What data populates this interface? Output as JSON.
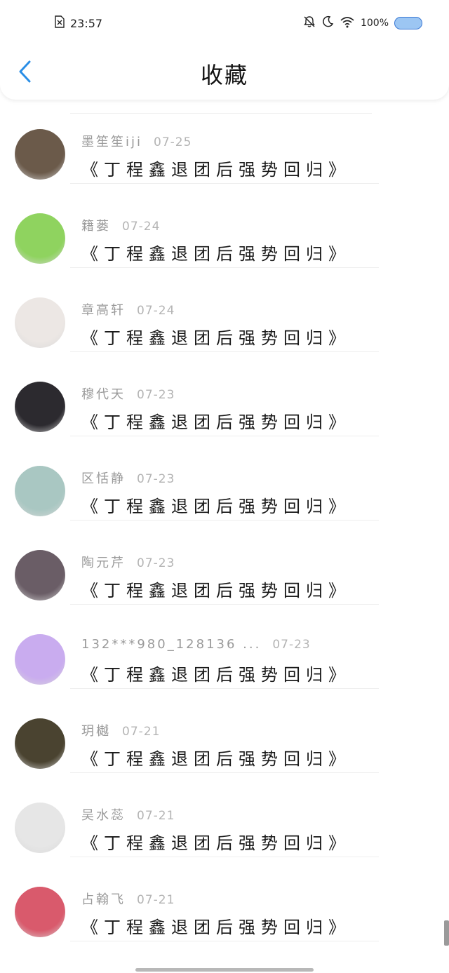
{
  "status": {
    "time": "23:57",
    "battery": "100%"
  },
  "header": {
    "title": "收藏"
  },
  "items": [
    {
      "author": "墨笙笙iji",
      "date": "07-25",
      "title": "《丁程鑫退团后强势回归》",
      "avatar_color": "#6b5a4a"
    },
    {
      "author": "籍蒌",
      "date": "07-24",
      "title": "《丁程鑫退团后强势回归》",
      "avatar_color": "#8fd35f"
    },
    {
      "author": "章高轩",
      "date": "07-24",
      "title": "《丁程鑫退团后强势回归》",
      "avatar_color": "#ece7e4"
    },
    {
      "author": "穆代天",
      "date": "07-23",
      "title": "《丁程鑫退团后强势回归》",
      "avatar_color": "#2c2a2f"
    },
    {
      "author": "区恬静",
      "date": "07-23",
      "title": "《丁程鑫退团后强势回归》",
      "avatar_color": "#a9c7c2"
    },
    {
      "author": "陶元芹",
      "date": "07-23",
      "title": "《丁程鑫退团后强势回归》",
      "avatar_color": "#6a5d66"
    },
    {
      "author": "132***980_128136 ...",
      "date": "07-23",
      "title": "《丁程鑫退团后强势回归》",
      "avatar_color": "#c9acef"
    },
    {
      "author": "玥樾",
      "date": "07-21",
      "title": "《丁程鑫退团后强势回归》",
      "avatar_color": "#4a4330"
    },
    {
      "author": "吴水蕊",
      "date": "07-21",
      "title": "《丁程鑫退团后强势回归》",
      "avatar_color": "#e6e6e6"
    },
    {
      "author": "占翰飞",
      "date": "07-21",
      "title": "《丁程鑫退团后强势回归》",
      "avatar_color": "#d95a6c"
    }
  ],
  "colors": {
    "accent": "#2a8ee6",
    "battery_fill": "#9cc6f3"
  },
  "icons": {
    "back": "chevron-left-icon",
    "sim": "sim-card-icon",
    "mute": "bell-off-icon",
    "moon": "moon-icon",
    "wifi": "wifi-icon",
    "battery": "battery-icon"
  }
}
